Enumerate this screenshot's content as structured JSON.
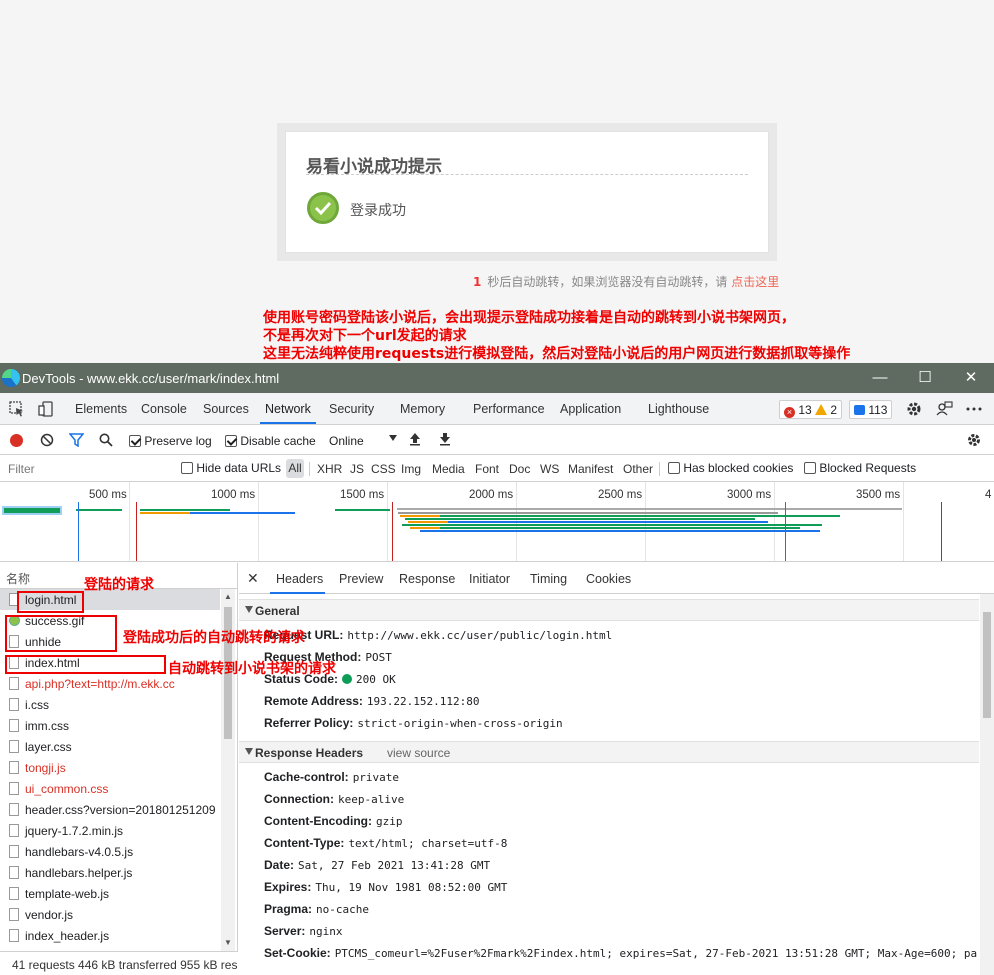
{
  "page": {
    "dialog_title": "易看小说成功提示",
    "success_text": "登录成功",
    "redirect_seconds": "1",
    "redirect_text": "秒后自动跳转，如果浏览器没有自动跳转，请",
    "redirect_link": "点击这里",
    "annotation_lines": [
      "使用账号密码登陆该小说后，会出现提示登陆成功接着是自动的跳转到小说书架网页，",
      "不是再次对下一个url发起的请求",
      "这里无法纯粹使用requests进行模拟登陆，然后对登陆小说后的用户网页进行数据抓取等操作"
    ]
  },
  "window": {
    "title": "DevTools - www.ekk.cc/user/mark/index.html",
    "minimize": "—",
    "maximize": "☐",
    "close": "✕"
  },
  "tabs": [
    "Elements",
    "Console",
    "Sources",
    "Network",
    "Security",
    "Memory",
    "Performance",
    "Application",
    "Lighthouse"
  ],
  "active_tab": "Network",
  "badges": {
    "errors": "13",
    "warnings": "2",
    "messages": "113"
  },
  "toolbar": {
    "preserve_log": "Preserve log",
    "preserve_log_checked": true,
    "disable_cache": "Disable cache",
    "disable_cache_checked": true,
    "throttling": "Online"
  },
  "filter": {
    "placeholder": "Filter",
    "hide_data_urls": "Hide data URLs",
    "types": [
      "All",
      "XHR",
      "JS",
      "CSS",
      "Img",
      "Media",
      "Font",
      "Doc",
      "WS",
      "Manifest",
      "Other"
    ],
    "has_blocked_cookies": "Has blocked cookies",
    "blocked_requests": "Blocked Requests"
  },
  "overview": {
    "ticks": [
      "500 ms",
      "1000 ms",
      "1500 ms",
      "2000 ms",
      "2500 ms",
      "3000 ms",
      "3500 ms",
      "4"
    ]
  },
  "requests": {
    "header": "名称",
    "items": [
      {
        "name": "login.html",
        "selected": true,
        "error": false,
        "icon": "file"
      },
      {
        "name": "success.gif",
        "selected": false,
        "error": false,
        "icon": "gif"
      },
      {
        "name": "unhide",
        "selected": false,
        "error": false,
        "icon": "file"
      },
      {
        "name": "index.html",
        "selected": false,
        "error": false,
        "icon": "file"
      },
      {
        "name": "api.php?text=http://m.ekk.cc",
        "selected": false,
        "error": true,
        "icon": "file"
      },
      {
        "name": "i.css",
        "selected": false,
        "error": false,
        "icon": "file"
      },
      {
        "name": "imm.css",
        "selected": false,
        "error": false,
        "icon": "file"
      },
      {
        "name": "layer.css",
        "selected": false,
        "error": false,
        "icon": "file"
      },
      {
        "name": "tongji.js",
        "selected": false,
        "error": true,
        "icon": "file"
      },
      {
        "name": "ui_common.css",
        "selected": false,
        "error": true,
        "icon": "file"
      },
      {
        "name": "header.css?version=201801251209",
        "selected": false,
        "error": false,
        "icon": "file"
      },
      {
        "name": "jquery-1.7.2.min.js",
        "selected": false,
        "error": false,
        "icon": "file"
      },
      {
        "name": "handlebars-v4.0.5.js",
        "selected": false,
        "error": false,
        "icon": "file"
      },
      {
        "name": "handlebars.helper.js",
        "selected": false,
        "error": false,
        "icon": "file"
      },
      {
        "name": "template-web.js",
        "selected": false,
        "error": false,
        "icon": "file"
      },
      {
        "name": "vendor.js",
        "selected": false,
        "error": false,
        "icon": "file"
      },
      {
        "name": "index_header.js",
        "selected": false,
        "error": false,
        "icon": "file"
      }
    ],
    "status": "41 requests  446 kB transferred  955 kB res"
  },
  "details": {
    "close": "✕",
    "tabs": [
      "Headers",
      "Preview",
      "Response",
      "Initiator",
      "Timing",
      "Cookies"
    ],
    "general_label": "General",
    "general": [
      {
        "k": "Request URL:",
        "v": "http://www.ekk.cc/user/public/login.html"
      },
      {
        "k": "Request Method:",
        "v": "POST"
      },
      {
        "k": "Status Code:",
        "v": "200 OK"
      },
      {
        "k": "Remote Address:",
        "v": "193.22.152.112:80"
      },
      {
        "k": "Referrer Policy:",
        "v": "strict-origin-when-cross-origin"
      }
    ],
    "response_label": "Response Headers",
    "view_source": "view source",
    "response": [
      {
        "k": "Cache-control:",
        "v": "private"
      },
      {
        "k": "Connection:",
        "v": "keep-alive"
      },
      {
        "k": "Content-Encoding:",
        "v": "gzip"
      },
      {
        "k": "Content-Type:",
        "v": "text/html; charset=utf-8"
      },
      {
        "k": "Date:",
        "v": "Sat, 27 Feb 2021 13:41:28 GMT"
      },
      {
        "k": "Expires:",
        "v": "Thu, 19 Nov 1981 08:52:00 GMT"
      },
      {
        "k": "Pragma:",
        "v": "no-cache"
      },
      {
        "k": "Server:",
        "v": "nginx"
      },
      {
        "k": "Set-Cookie:",
        "v": "PTCMS_comeurl=%2Fuser%2Fmark%2Findex.html; expires=Sat, 27-Feb-2021 13:51:28 GMT; Max-Age=600; pa"
      }
    ]
  },
  "annotations": {
    "login_request": "登陆的请求",
    "redirect_requests": "登陆成功后的自动跳转的请求",
    "bookshelf_request": "自动跳转到小说书架的请求"
  }
}
